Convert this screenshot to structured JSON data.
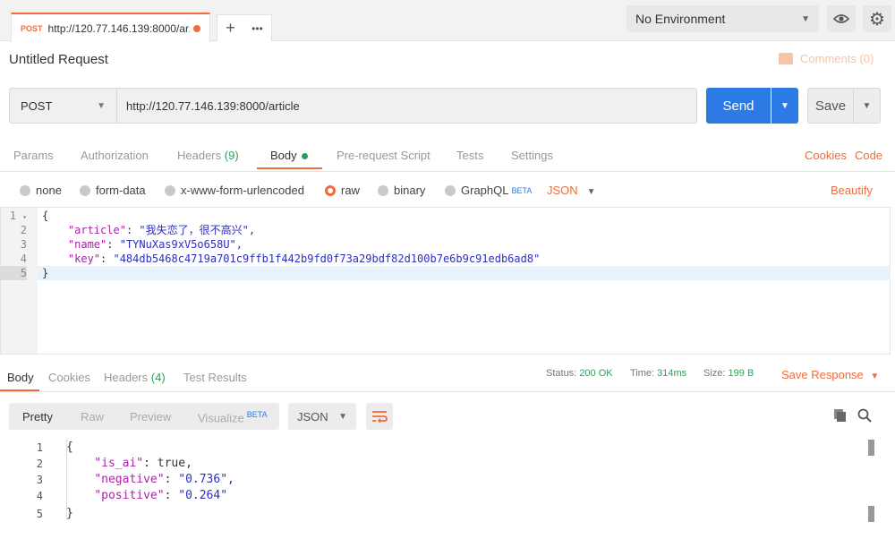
{
  "tabs": {
    "active": {
      "method": "POST",
      "url": "http://120.77.146.139:8000/ar..."
    },
    "add_label": "+",
    "more_label": "•••"
  },
  "environment": {
    "selected": "No Environment"
  },
  "request": {
    "title": "Untitled Request",
    "comments_label": "Comments (0)",
    "method": "POST",
    "url": "http://120.77.146.139:8000/article",
    "send_label": "Send",
    "save_label": "Save"
  },
  "request_tabs": {
    "params": "Params",
    "authorization": "Authorization",
    "headers": "Headers",
    "headers_count": "(9)",
    "body": "Body",
    "pre_request": "Pre-request Script",
    "tests": "Tests",
    "settings": "Settings",
    "cookies": "Cookies",
    "code": "Code"
  },
  "body_types": {
    "none": "none",
    "form_data": "form-data",
    "urlencoded": "x-www-form-urlencoded",
    "raw": "raw",
    "binary": "binary",
    "graphql": "GraphQL",
    "beta": "BETA",
    "format": "JSON",
    "beautify": "Beautify",
    "selected": "raw"
  },
  "request_body": {
    "line_numbers": [
      "1",
      "2",
      "3",
      "4",
      "5"
    ],
    "open": "{",
    "close": "}",
    "fields": [
      {
        "key": "\"article\"",
        "value": "\"我失恋了，很不高兴\","
      },
      {
        "key": "\"name\"",
        "value": "\"TYNuXas9xV5o658U\","
      },
      {
        "key": "\"key\"",
        "value": "\"484db5468c4719a701c9ffb1f442b9fd0f73a29bdf82d100b7e6b9c91edb6ad8\""
      }
    ]
  },
  "response_tabs": {
    "body": "Body",
    "cookies": "Cookies",
    "headers": "Headers",
    "headers_count": "(4)",
    "test_results": "Test Results"
  },
  "response_status": {
    "status_label": "Status:",
    "status_value": "200 OK",
    "time_label": "Time:",
    "time_value": "314ms",
    "size_label": "Size:",
    "size_value": "199 B",
    "save_response": "Save Response"
  },
  "response_view": {
    "pretty": "Pretty",
    "raw": "Raw",
    "preview": "Preview",
    "visualize": "Visualize",
    "beta": "BETA",
    "format": "JSON"
  },
  "response_body": {
    "line_numbers": [
      "1",
      "2",
      "3",
      "4",
      "5"
    ],
    "open": "{",
    "close": "}",
    "fields": [
      {
        "key": "\"is_ai\"",
        "value": "true,"
      },
      {
        "key": "\"negative\"",
        "value": "\"0.736\","
      },
      {
        "key": "\"positive\"",
        "value": "\"0.264\""
      }
    ]
  },
  "colors": {
    "accent": "#f26b3a",
    "send": "#2c7be5",
    "success": "#2e9e5b"
  }
}
